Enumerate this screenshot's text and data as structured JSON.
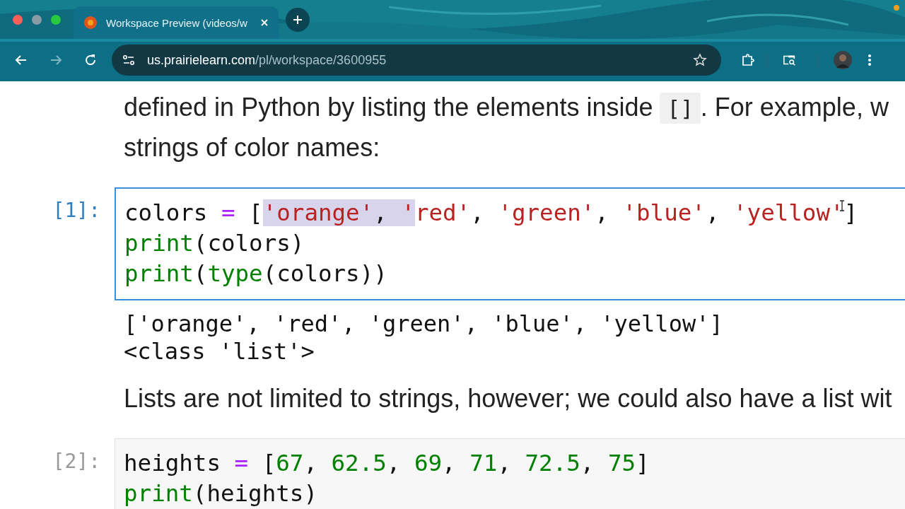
{
  "browser": {
    "tab": {
      "title": "Workspace Preview (videos/w",
      "selected": true
    },
    "url_host": "us.prairielearn.com",
    "url_path": "/pl/workspace/3600955"
  },
  "notebook": [
    {
      "kind": "prose",
      "lines": [
        [
          {
            "kind": "text",
            "text": "defined in Python by listing the elements inside "
          },
          {
            "kind": "code",
            "text": "[]"
          },
          {
            "kind": "text",
            "text": ". For example, w"
          }
        ],
        [
          {
            "kind": "text",
            "text": "strings of color names:"
          }
        ]
      ]
    },
    {
      "kind": "code_cell",
      "prompt": "[1]:",
      "active": true,
      "lines": [
        [
          {
            "kind": "plain",
            "text": "colors ",
            "highlighted": false
          },
          {
            "kind": "operator",
            "text": "=",
            "highlighted": false
          },
          {
            "kind": "plain",
            "text": " [",
            "highlighted": false
          },
          {
            "kind": "string",
            "text": "'orange'",
            "highlighted": true
          },
          {
            "kind": "plain",
            "text": ", ",
            "highlighted": true
          },
          {
            "kind": "string",
            "text": "'",
            "highlighted": true
          },
          {
            "kind": "string",
            "text": "red'",
            "highlighted": false
          },
          {
            "kind": "plain",
            "text": ", ",
            "highlighted": false
          },
          {
            "kind": "string",
            "text": "'green'",
            "highlighted": false
          },
          {
            "kind": "plain",
            "text": ", ",
            "highlighted": false
          },
          {
            "kind": "string",
            "text": "'blue'",
            "highlighted": false
          },
          {
            "kind": "plain",
            "text": ", ",
            "highlighted": false
          },
          {
            "kind": "string",
            "text": "'yellow'",
            "highlighted": false
          },
          {
            "kind": "plain",
            "text": "]",
            "highlighted": false
          }
        ],
        [
          {
            "kind": "builtin",
            "text": "print"
          },
          {
            "kind": "plain",
            "text": "(colors)"
          }
        ],
        [
          {
            "kind": "builtin",
            "text": "print"
          },
          {
            "kind": "plain",
            "text": "("
          },
          {
            "kind": "builtin",
            "text": "type"
          },
          {
            "kind": "plain",
            "text": "(colors))"
          }
        ]
      ],
      "output": [
        "['orange', 'red', 'green', 'blue', 'yellow']",
        "<class 'list'>"
      ]
    },
    {
      "kind": "prose",
      "lines": [
        [
          {
            "kind": "text",
            "text": "Lists are not limited to strings, however; we could also have a list wit"
          }
        ]
      ]
    },
    {
      "kind": "code_cell",
      "prompt": "[2]:",
      "active": false,
      "lines": [
        [
          {
            "kind": "plain",
            "text": "heights "
          },
          {
            "kind": "operator",
            "text": "="
          },
          {
            "kind": "plain",
            "text": " ["
          },
          {
            "kind": "number",
            "text": "67"
          },
          {
            "kind": "plain",
            "text": ", "
          },
          {
            "kind": "number",
            "text": "62.5"
          },
          {
            "kind": "plain",
            "text": ", "
          },
          {
            "kind": "number",
            "text": "69"
          },
          {
            "kind": "plain",
            "text": ", "
          },
          {
            "kind": "number",
            "text": "71"
          },
          {
            "kind": "plain",
            "text": ", "
          },
          {
            "kind": "number",
            "text": "72.5"
          },
          {
            "kind": "plain",
            "text": ", "
          },
          {
            "kind": "number",
            "text": "75"
          },
          {
            "kind": "plain",
            "text": "]"
          }
        ],
        [
          {
            "kind": "builtin",
            "text": "print"
          },
          {
            "kind": "plain",
            "text": "(heights)"
          }
        ]
      ]
    }
  ]
}
